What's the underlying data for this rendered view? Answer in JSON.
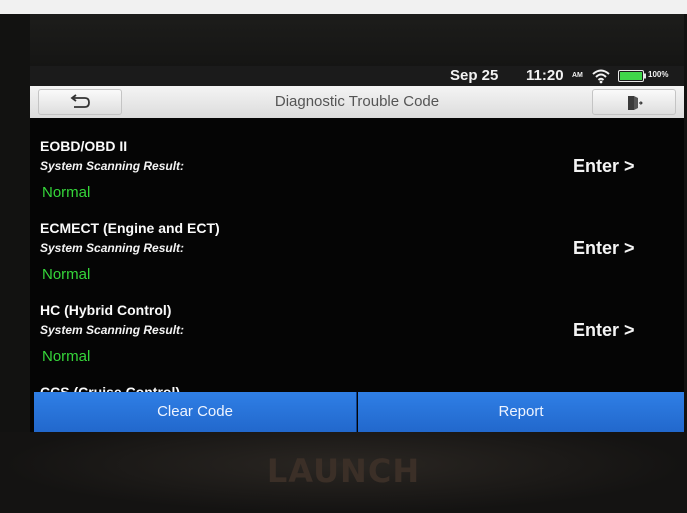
{
  "status_bar": {
    "date": "Sep 25",
    "time": "11:20",
    "ampm": "AM",
    "battery_percent": "100%",
    "battery_level": 1.0,
    "wifi_icon": "wifi-icon",
    "battery_icon": "battery-icon"
  },
  "title_bar": {
    "title": "Diagnostic Trouble Code",
    "back_icon": "back-arrow-icon",
    "exit_icon": "exit-icon"
  },
  "systems": [
    {
      "name": "EOBD/OBD II",
      "result_label": "System Scanning Result:",
      "status": "Normal",
      "enter_label": "Enter >"
    },
    {
      "name": "ECMECT (Engine and ECT)",
      "result_label": "System Scanning Result:",
      "status": "Normal",
      "enter_label": "Enter >"
    },
    {
      "name": "HC (Hybrid Control)",
      "result_label": "System Scanning Result:",
      "status": "Normal",
      "enter_label": "Enter >"
    },
    {
      "name": "CCS (Cruise Control)",
      "result_label": "",
      "status": "",
      "enter_label": ""
    }
  ],
  "actions": {
    "clear_code_label": "Clear Code",
    "report_label": "Report"
  },
  "device": {
    "brand": "LAUNCH"
  },
  "colors": {
    "status_ok": "#35d63a",
    "action_blue": "#2a74dc",
    "screen_bg": "#050505"
  }
}
